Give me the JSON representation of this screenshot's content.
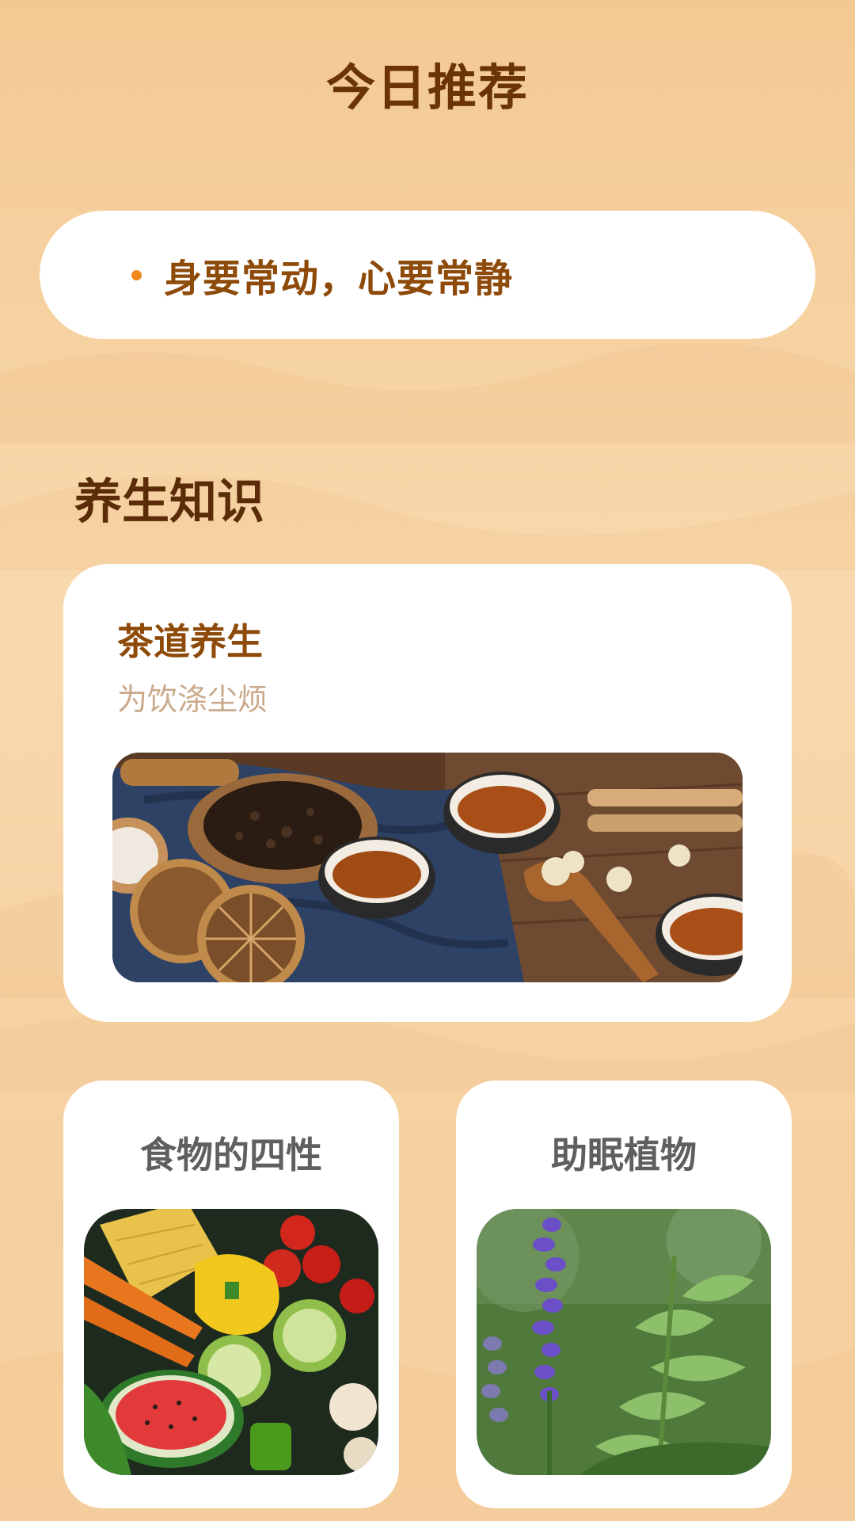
{
  "header": {
    "title": "今日推荐"
  },
  "tip": {
    "text": "身要常动，心要常静",
    "bullet_color": "#f08a1d"
  },
  "knowledge": {
    "section_title": "养生知识",
    "featured": {
      "title": "茶道养生",
      "subtitle": "为饮涤尘烦",
      "image": "tea-photo"
    },
    "cards": [
      {
        "title": "食物的四性",
        "image": "vegetables-photo"
      },
      {
        "title": "助眠植物",
        "image": "lavender-plant-photo"
      }
    ]
  },
  "colors": {
    "background": "#f6d2a2",
    "title_brown": "#6b3408",
    "accent_brown": "#8e4a08",
    "subtitle_tan": "#c9a98a",
    "card_white": "#ffffff"
  }
}
